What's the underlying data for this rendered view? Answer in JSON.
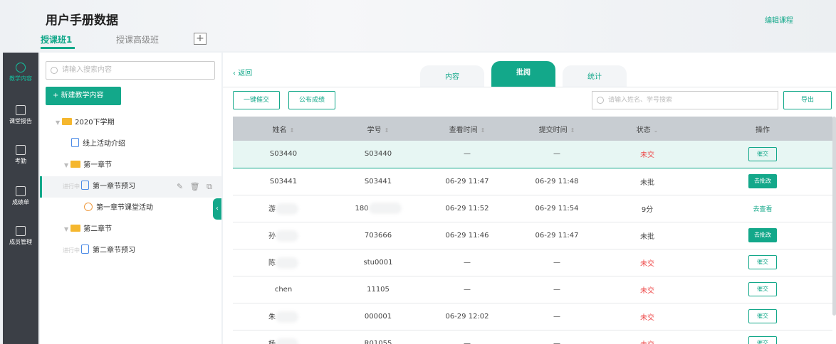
{
  "header": {
    "title": "用户手册数据",
    "tabs": [
      {
        "label": "授课班1",
        "active": true
      },
      {
        "label": "授课高级班",
        "active": false
      }
    ],
    "add_tab_label": "+",
    "edit_course_label": "编辑课程"
  },
  "rail": [
    {
      "label": "教学内容",
      "icon": "layers-icon",
      "active": true
    },
    {
      "label": "课堂报告",
      "icon": "report-icon"
    },
    {
      "label": "考勤",
      "icon": "calendar-check-icon"
    },
    {
      "label": "成绩单",
      "icon": "grade-icon"
    },
    {
      "label": "成员管理",
      "icon": "members-icon"
    }
  ],
  "tree": {
    "search_placeholder": "请输入搜索内容",
    "new_button_label": "+ 新建教学内容",
    "items": [
      {
        "label": "2020下学期",
        "type": "folder"
      },
      {
        "label": "线上活动介绍",
        "type": "doc"
      },
      {
        "label": "第一章节",
        "type": "folder"
      },
      {
        "label": "第一章节预习",
        "type": "doc",
        "tag": "进行中",
        "selected": true
      },
      {
        "label": "第一章节课堂活动",
        "type": "activity"
      },
      {
        "label": "第二章节",
        "type": "folder"
      },
      {
        "label": "第二章节预习",
        "type": "doc",
        "tag": "进行中"
      }
    ],
    "row_tools": "✎ 🗑 ⧉"
  },
  "main": {
    "back_label": "返回",
    "tabs": [
      {
        "label": "内容",
        "active": false
      },
      {
        "label": "批阅",
        "active": true
      },
      {
        "label": "统计",
        "active": false
      }
    ],
    "remind_all_label": "一键催交",
    "publish_label": "公布成绩",
    "search_placeholder": "请输入姓名、学号搜索",
    "export_label": "导出",
    "columns": [
      "姓名",
      "学号",
      "查看时间",
      "提交时间",
      "状态",
      "操作"
    ],
    "rows": [
      {
        "name": "S03440",
        "id": "S03440",
        "view": "—",
        "submit": "—",
        "status": "未交",
        "status_red": true,
        "action": "催交",
        "action_style": "outline"
      },
      {
        "name": "S03441",
        "id": "S03441",
        "view": "06-29 11:47",
        "submit": "06-29 11:48",
        "status": "未批",
        "action": "去批改",
        "action_style": "fill"
      },
      {
        "name": "游",
        "id": "180",
        "view": "06-29 11:52",
        "submit": "06-29 11:54",
        "status": "9分",
        "action": "去查看",
        "action_style": "link"
      },
      {
        "name": "孙",
        "id": "703666",
        "view": "06-29 11:46",
        "submit": "06-29 11:47",
        "status": "未批",
        "action": "去批改",
        "action_style": "fill"
      },
      {
        "name": "陈",
        "id": "stu0001",
        "view": "—",
        "submit": "—",
        "status": "未交",
        "status_red": true,
        "action": "催交",
        "action_style": "outline"
      },
      {
        "name": "chen",
        "id": "11105",
        "view": "—",
        "submit": "—",
        "status": "未交",
        "status_red": true,
        "action": "催交",
        "action_style": "outline"
      },
      {
        "name": "朱",
        "id": "000001",
        "view": "06-29 12:02",
        "submit": "—",
        "status": "未交",
        "status_red": true,
        "action": "催交",
        "action_style": "outline"
      },
      {
        "name": "杨",
        "id": "R01055",
        "view": "—",
        "submit": "—",
        "status": "未交",
        "status_red": true,
        "action": "催交",
        "action_style": "outline"
      }
    ]
  }
}
